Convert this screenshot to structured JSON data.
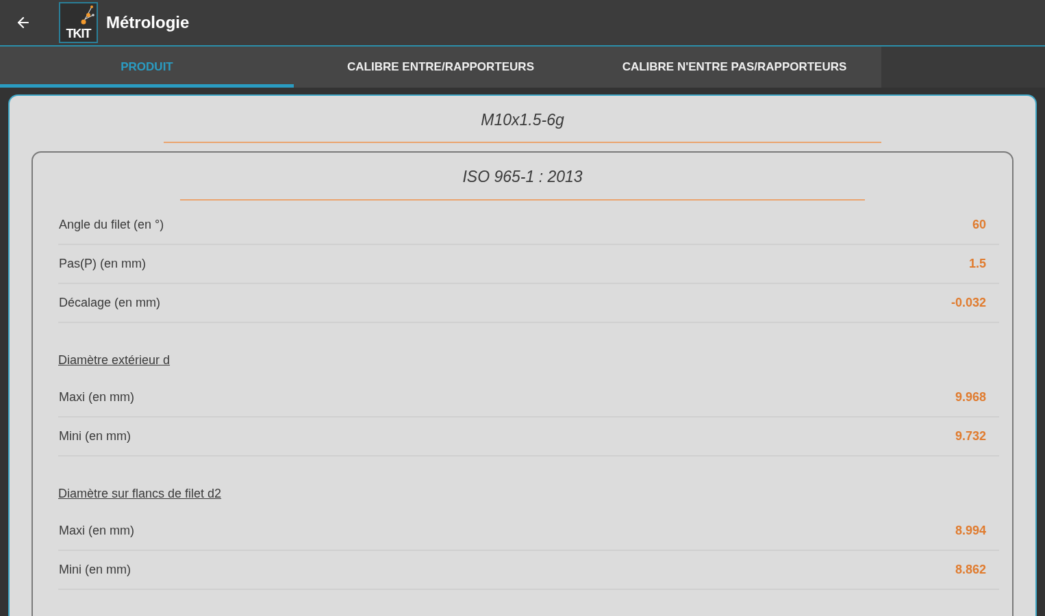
{
  "app_bar": {
    "title": "Métrologie",
    "logo_text": "TKIT"
  },
  "tabs": [
    {
      "label": "PRODUIT",
      "selected": true
    },
    {
      "label": "CALIBRE ENTRE/RAPPORTEURS",
      "selected": false
    },
    {
      "label": "CALIBRE N'ENTRE PAS/RAPPORTEURS",
      "selected": false
    }
  ],
  "product": {
    "title": "M10x1.5-6g",
    "standard": {
      "title": "ISO 965-1 : 2013",
      "groups": [
        {
          "rows": [
            {
              "label": "Angle du filet (en °)",
              "value": "60"
            },
            {
              "label": "Pas(P) (en mm)",
              "value": "1.5"
            },
            {
              "label": "Décalage (en mm)",
              "value": "-0.032"
            }
          ]
        },
        {
          "heading": "Diamètre extérieur d",
          "rows": [
            {
              "label": "Maxi (en mm)",
              "value": "9.968"
            },
            {
              "label": "Mini (en mm)",
              "value": "9.732"
            }
          ]
        },
        {
          "heading": "Diamètre sur flancs de filet d2",
          "rows": [
            {
              "label": "Maxi (en mm)",
              "value": "8.994"
            },
            {
              "label": "Mini (en mm)",
              "value": "8.862"
            }
          ]
        }
      ]
    }
  }
}
